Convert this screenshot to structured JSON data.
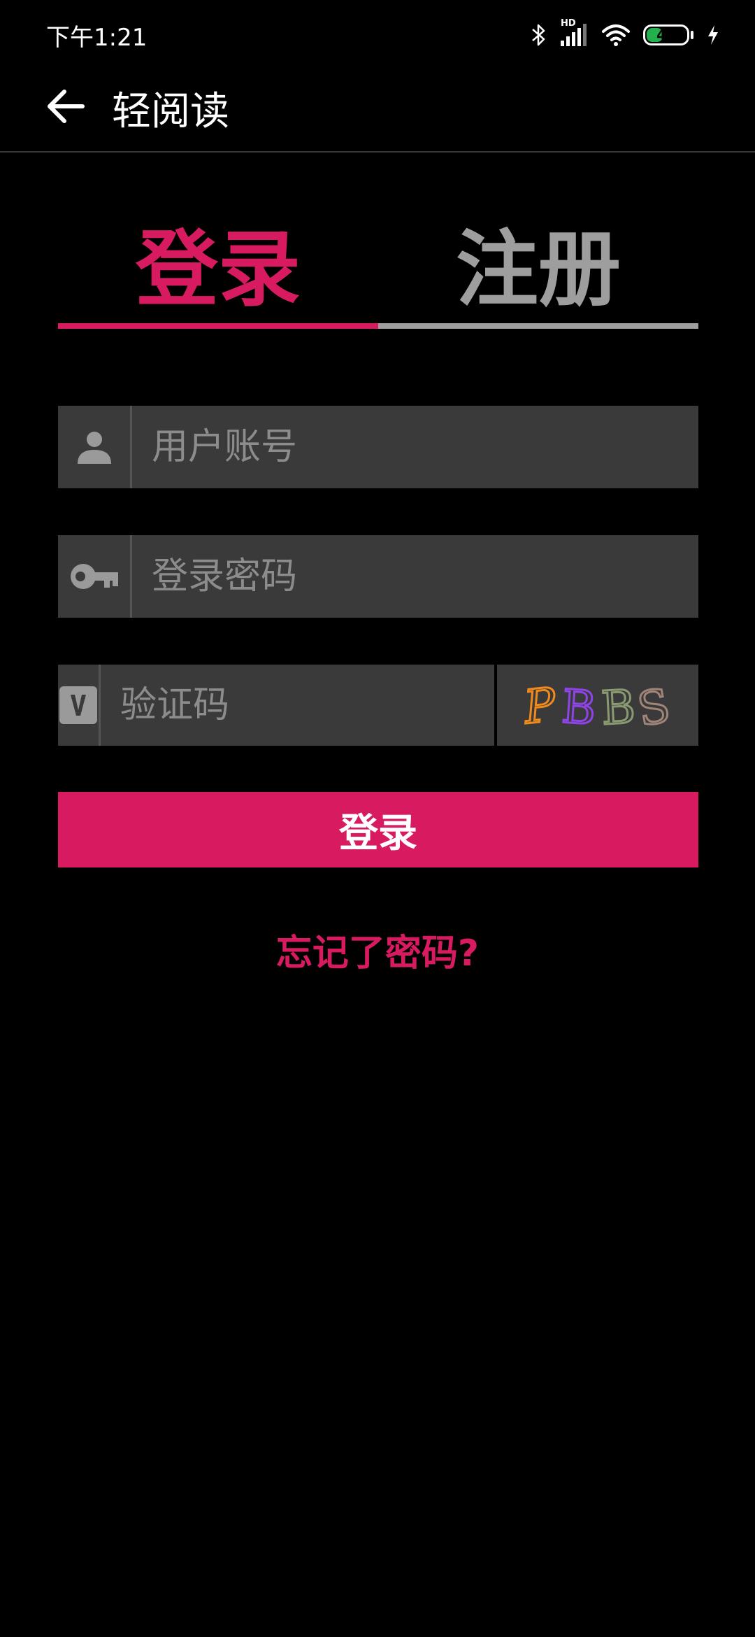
{
  "status_bar": {
    "time": "下午1:21",
    "network_label": "HD",
    "battery_level": "41",
    "battery_percent": 41
  },
  "app_bar": {
    "title": "轻阅读",
    "back_icon": "arrow-back-icon"
  },
  "tabs": {
    "login_label": "登录",
    "register_label": "注册",
    "active": "login"
  },
  "form": {
    "account_placeholder": "用户账号",
    "account_value": "",
    "password_placeholder": "登录密码",
    "password_value": "",
    "captcha_placeholder": "验证码",
    "captcha_value": "",
    "captcha_image_text": "PBBS",
    "account_icon": "person-icon",
    "password_icon": "key-icon",
    "captcha_icon": "verify-v-icon"
  },
  "actions": {
    "login_button": "登录",
    "forgot_password": "忘记了密码?"
  },
  "colors": {
    "accent": "#d81b60",
    "inactive": "#9e9e9e",
    "field_bg": "#3a3a3a",
    "background": "#000000"
  }
}
